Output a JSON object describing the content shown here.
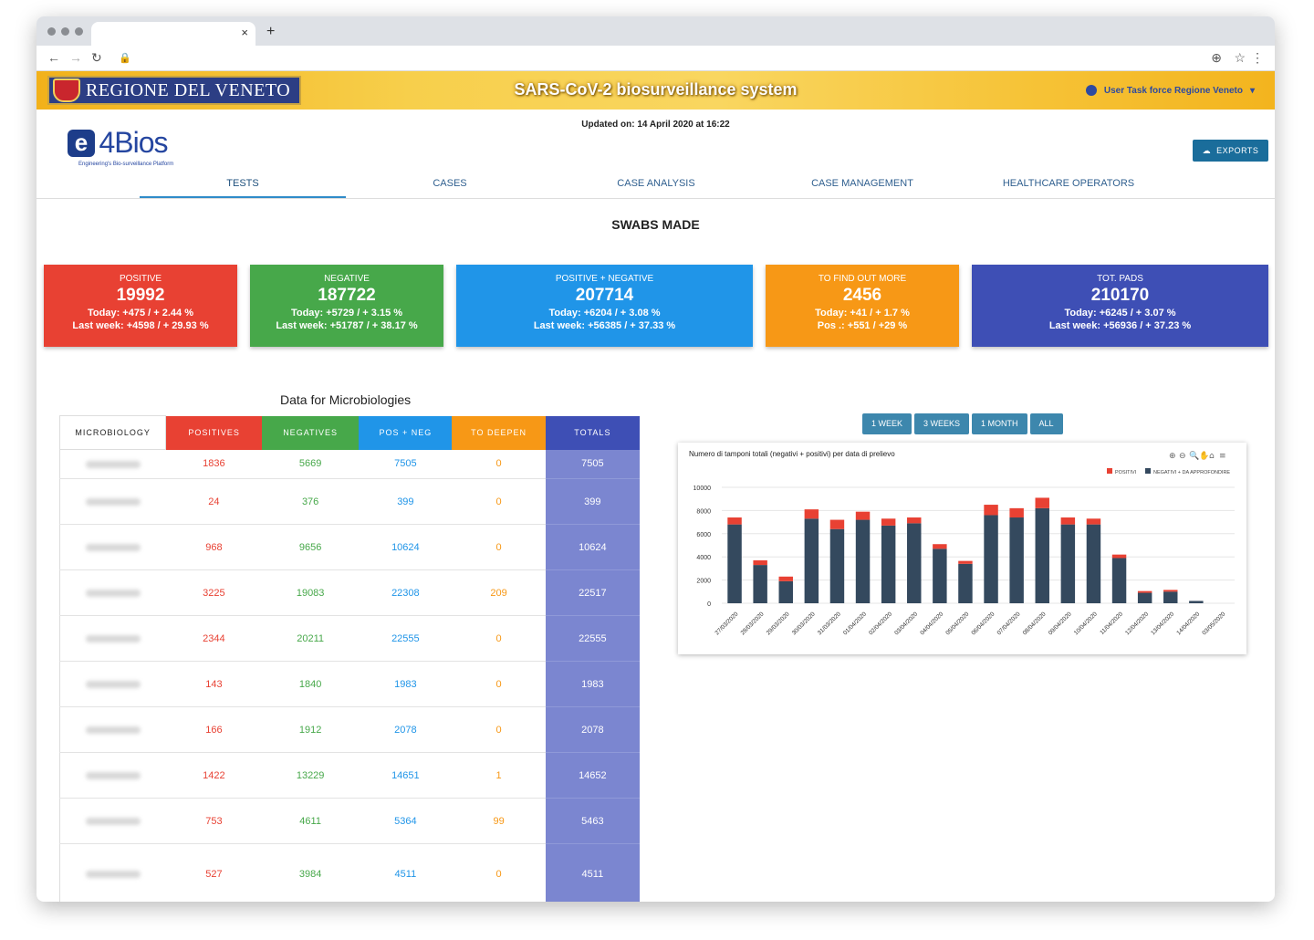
{
  "browser": {
    "tab_close": "×",
    "new_tab": "+"
  },
  "banner": {
    "region": "REGIONE DEL VENETO",
    "title": "SARS-CoV-2 biosurveillance system",
    "user": "User Task force Regione Veneto"
  },
  "header": {
    "updated": "Updated on: 14 April 2020 at 16:22",
    "logo_mark": "e",
    "logo_name": "4Bios",
    "logo_tagline": "Engineering's Bio-surveillance Platform",
    "exports": "EXPORTS"
  },
  "nav": [
    "TESTS",
    "CASES",
    "CASE ANALYSIS",
    "CASE MANAGEMENT",
    "HEALTHCARE OPERATORS"
  ],
  "section_title": "SWABS MADE",
  "cards": [
    {
      "title": "POSITIVE",
      "value": "19992",
      "line1": "Today: +475  / + 2.44 %",
      "line2": "Last week: +4598  / + 29.93 %",
      "color": "#e84133"
    },
    {
      "title": "NEGATIVE",
      "value": "187722",
      "line1": "Today: +5729  / + 3.15 %",
      "line2": "Last week: +51787  / + 38.17 %",
      "color": "#47a84a"
    },
    {
      "title": "POSITIVE + NEGATIVE",
      "value": "207714",
      "line1": "Today: +6204  / + 3.08 %",
      "line2": "Last week: +56385  / + 37.33 %",
      "color": "#2095e8"
    },
    {
      "title": "TO FIND OUT MORE",
      "value": "2456",
      "line1": "Today: +41  / + 1.7 %",
      "line2": "Pos .: +551  /  +29 %",
      "color": "#f79816"
    },
    {
      "title": "TOT. PADS",
      "value": "210170",
      "line1": "Today: +6245  / + 3.07 %",
      "line2": "Last week: +56936  / + 37.23 %",
      "color": "#3e4fb5"
    }
  ],
  "micro": {
    "title": "Data for Microbiologies",
    "headers": [
      "MICROBIOLOGY",
      "POSITIVES",
      "NEGATIVES",
      "POS + NEG",
      "TO DEEPEN",
      "TOTALS"
    ],
    "header_colors": [
      "#ffffff",
      "#e84133",
      "#47a84a",
      "#2095e8",
      "#f79816",
      "#3e4fb5"
    ],
    "rows": [
      [
        "1836",
        "5669",
        "7505",
        "0",
        "7505"
      ],
      [
        "24",
        "376",
        "399",
        "0",
        "399"
      ],
      [
        "968",
        "9656",
        "10624",
        "0",
        "10624"
      ],
      [
        "3225",
        "19083",
        "22308",
        "209",
        "22517"
      ],
      [
        "2344",
        "20211",
        "22555",
        "0",
        "22555"
      ],
      [
        "143",
        "1840",
        "1983",
        "0",
        "1983"
      ],
      [
        "166",
        "1912",
        "2078",
        "0",
        "2078"
      ],
      [
        "1422",
        "13229",
        "14651",
        "1",
        "14652"
      ],
      [
        "753",
        "4611",
        "5364",
        "99",
        "5463"
      ],
      [
        "527",
        "3984",
        "4511",
        "0",
        "4511"
      ]
    ]
  },
  "range_buttons": [
    "1 WEEK",
    "3 WEEKS",
    "1 MONTH",
    "ALL"
  ],
  "chart_data": {
    "type": "bar",
    "title": "Numero di tamponi totali (negativi + positivi) per data di prelievo",
    "categories": [
      "27/03/2020",
      "28/03/2020",
      "29/03/2020",
      "30/03/2020",
      "31/03/2020",
      "01/04/2020",
      "02/04/2020",
      "03/04/2020",
      "04/04/2020",
      "05/04/2020",
      "06/04/2020",
      "07/04/2020",
      "08/04/2020",
      "09/04/2020",
      "10/04/2020",
      "11/04/2020",
      "12/04/2020",
      "13/04/2020",
      "14/04/2020",
      "03/05/2020"
    ],
    "series": [
      {
        "name": "NEGATIVI + DA APPROFONDIRE",
        "color": "#34495e",
        "values": [
          6800,
          3300,
          1900,
          7300,
          6400,
          7200,
          6700,
          6900,
          4700,
          3400,
          7600,
          7400,
          8200,
          6800,
          6800,
          3900,
          900,
          1000,
          200,
          0
        ]
      },
      {
        "name": "POSITIVI",
        "color": "#e84133",
        "values": [
          600,
          400,
          400,
          800,
          800,
          700,
          600,
          500,
          400,
          250,
          900,
          800,
          900,
          600,
          500,
          300,
          150,
          150,
          0,
          0
        ]
      }
    ],
    "ylim": [
      0,
      10000
    ],
    "yticks": [
      "10000",
      "8000",
      "6000",
      "4000",
      "2000",
      "0"
    ],
    "stacked": true,
    "legend": "top-right"
  }
}
